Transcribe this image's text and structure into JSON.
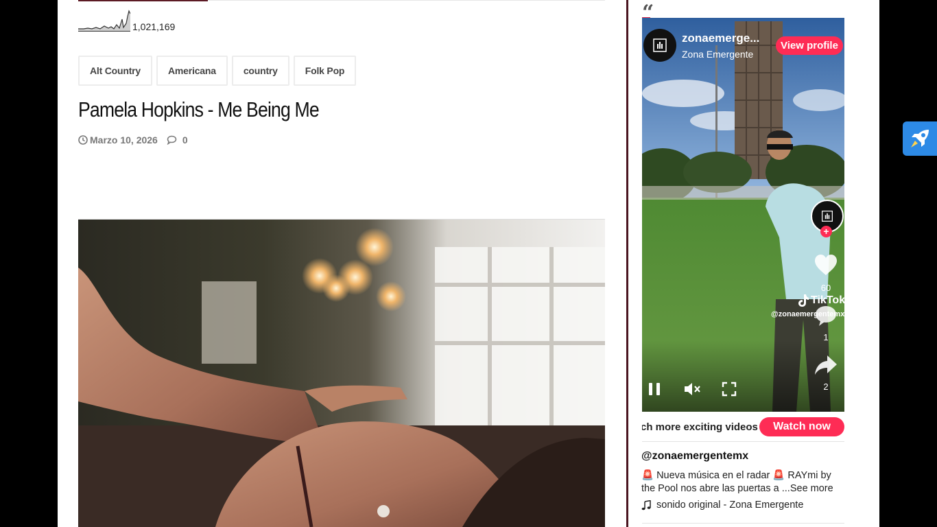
{
  "article": {
    "views_count": "1,021,169",
    "tags": [
      "Alt Country",
      "Americana",
      "country",
      "Folk Pop"
    ],
    "title": "Pamela Hopkins - Me Being Me",
    "date": "Marzo 10, 2026",
    "comment_count": "0"
  },
  "sidebar": {
    "quote_mark": "“",
    "tiktok": {
      "account_name": "zonaemerge...",
      "display_name": "Zona Emergente",
      "view_profile_label": "View profile",
      "follow_plus": "+",
      "like_count": "60",
      "comment_count": "1",
      "share_count": "2",
      "watermark_logo": "TikTok",
      "watermark_handle": "@zonaemergentemx",
      "marquee_text": "ch more exciting videos",
      "watch_now_label": "Watch now",
      "handle": "@zonaemergentemx",
      "caption": "🚨 Nueva música en el radar 🚨 RAYmi by the Pool nos abre las puertas a ...",
      "see_more_label": "See more",
      "sound": "sonido original - Zona Emergente"
    }
  },
  "colors": {
    "accent": "#e8294a",
    "brand_dark": "#5c1a24",
    "tiktok_red": "#fe2c55",
    "floating_button": "#2d8ae6"
  },
  "icons": [
    "sparkline-chart",
    "clock-icon",
    "comment-icon",
    "pause-icon",
    "mute-icon",
    "fullscreen-icon",
    "heart-icon",
    "share-icon",
    "music-note-icon",
    "rocket-icon"
  ]
}
